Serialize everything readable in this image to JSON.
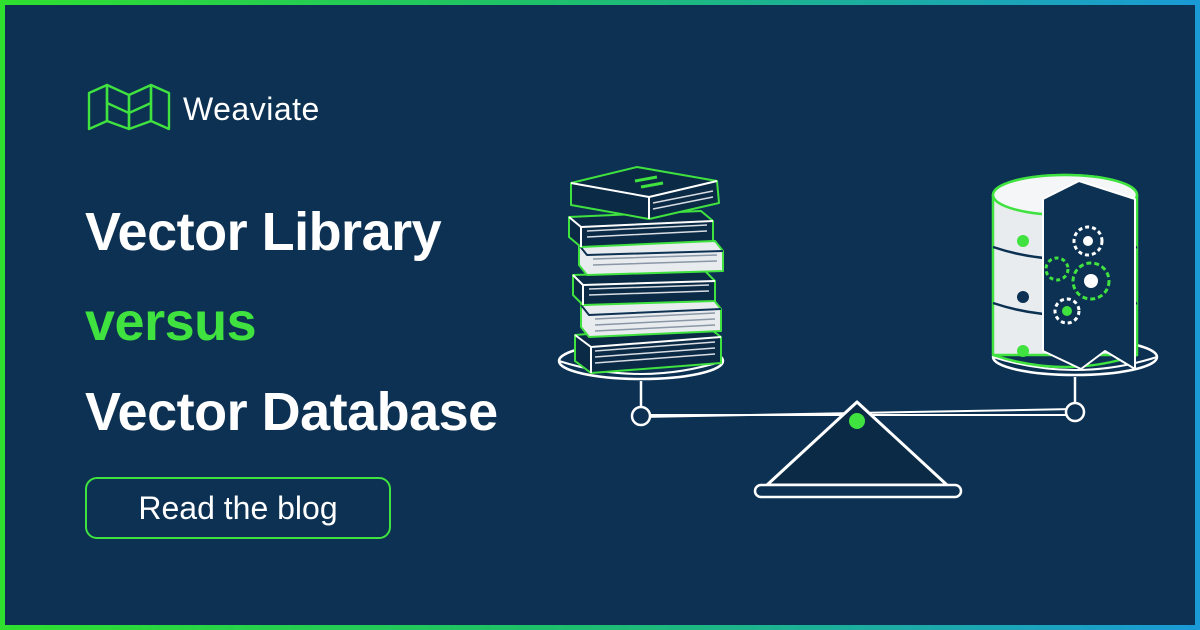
{
  "brand": {
    "name": "Weaviate",
    "logo_icon": "weaviate-logo-icon"
  },
  "headline": {
    "line1": "Vector Library",
    "line2": "versus",
    "line3": "Vector Database"
  },
  "cta": {
    "label": "Read the blog"
  },
  "illustration": {
    "left_item_icon": "book-stack-icon",
    "right_item_icon": "database-gears-icon",
    "balance_icon": "balance-scale-icon"
  },
  "colors": {
    "background": "#0c3152",
    "accent": "#3fe23f",
    "text": "#ffffff",
    "border_gradient": [
      "#2fe02f",
      "#1ec06a",
      "#1a9ad6"
    ]
  }
}
